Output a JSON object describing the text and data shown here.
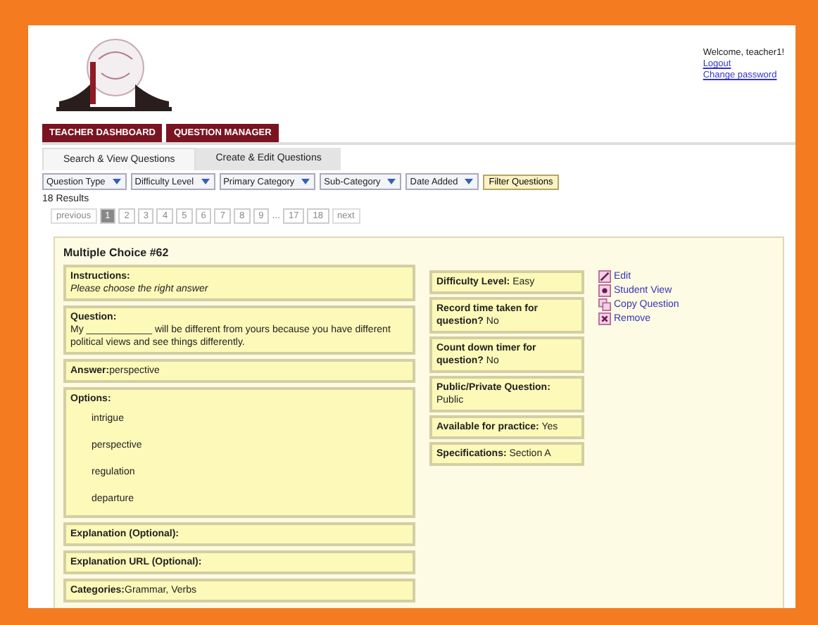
{
  "header": {
    "welcome": "Welcome, teacher1!",
    "links": [
      "Logout",
      "Change password"
    ]
  },
  "nav_tabs": [
    "TEACHER DASHBOARD",
    "QUESTION MANAGER"
  ],
  "sub_tabs": [
    {
      "label": "Search & View Questions",
      "selected": true
    },
    {
      "label": "Create & Edit Questions",
      "selected": false
    }
  ],
  "filters": [
    "Question Type",
    "Difficulty Level",
    "Primary Category",
    "Sub-Category",
    "Date Added"
  ],
  "filter_button": "Filter Questions",
  "results_count": "18 Results",
  "pagination": {
    "previous": "previous",
    "pages": [
      {
        "label": "1",
        "selected": true
      },
      {
        "label": "2",
        "selected": false
      },
      {
        "label": "3",
        "selected": false
      },
      {
        "label": "4",
        "selected": false
      },
      {
        "label": "5",
        "selected": false
      },
      {
        "label": "6",
        "selected": false
      },
      {
        "label": "7",
        "selected": false
      },
      {
        "label": "8",
        "selected": false
      },
      {
        "label": "9",
        "selected": false
      }
    ],
    "gap": "...",
    "last_pages": [
      {
        "label": "17",
        "selected": false
      },
      {
        "label": "18",
        "selected": false
      }
    ],
    "next": "next"
  },
  "card": {
    "title": "Multiple Choice #62",
    "sections": [
      {
        "kind": "note",
        "label": "Instructions:",
        "value": "Please choose the right answer"
      },
      {
        "kind": "block",
        "label": "Question:",
        "value": "My ____________ will be different from yours because you have different political views and see things differently."
      },
      {
        "kind": "inline",
        "label": "Answer:",
        "value": "perspective"
      },
      {
        "kind": "options",
        "label": "Options:",
        "options": [
          "intrigue",
          "perspective",
          "regulation",
          "departure"
        ]
      },
      {
        "kind": "inline",
        "label": "Explanation (Optional):"
      },
      {
        "kind": "inline",
        "label": "Explanation URL (Optional):"
      },
      {
        "kind": "inline",
        "label": "Categories:",
        "value": "Grammar, Verbs"
      }
    ],
    "fields": [
      {
        "label": "Difficulty Level:",
        "value": "Easy"
      },
      {
        "label": "Record time taken for question?",
        "value": "No"
      },
      {
        "label": "Count down timer for question?",
        "value": "No"
      },
      {
        "label": "Public/Private Question:",
        "value": "Public"
      },
      {
        "label": "Available for practice:",
        "value": "Yes"
      },
      {
        "label": "Specifications:",
        "value": "Section A"
      }
    ],
    "actions": [
      {
        "kind": "edit",
        "label": "Edit"
      },
      {
        "kind": "view",
        "label": "Student View"
      },
      {
        "kind": "copy",
        "label": "Copy Question"
      },
      {
        "kind": "remove",
        "label": "Remove"
      }
    ]
  }
}
